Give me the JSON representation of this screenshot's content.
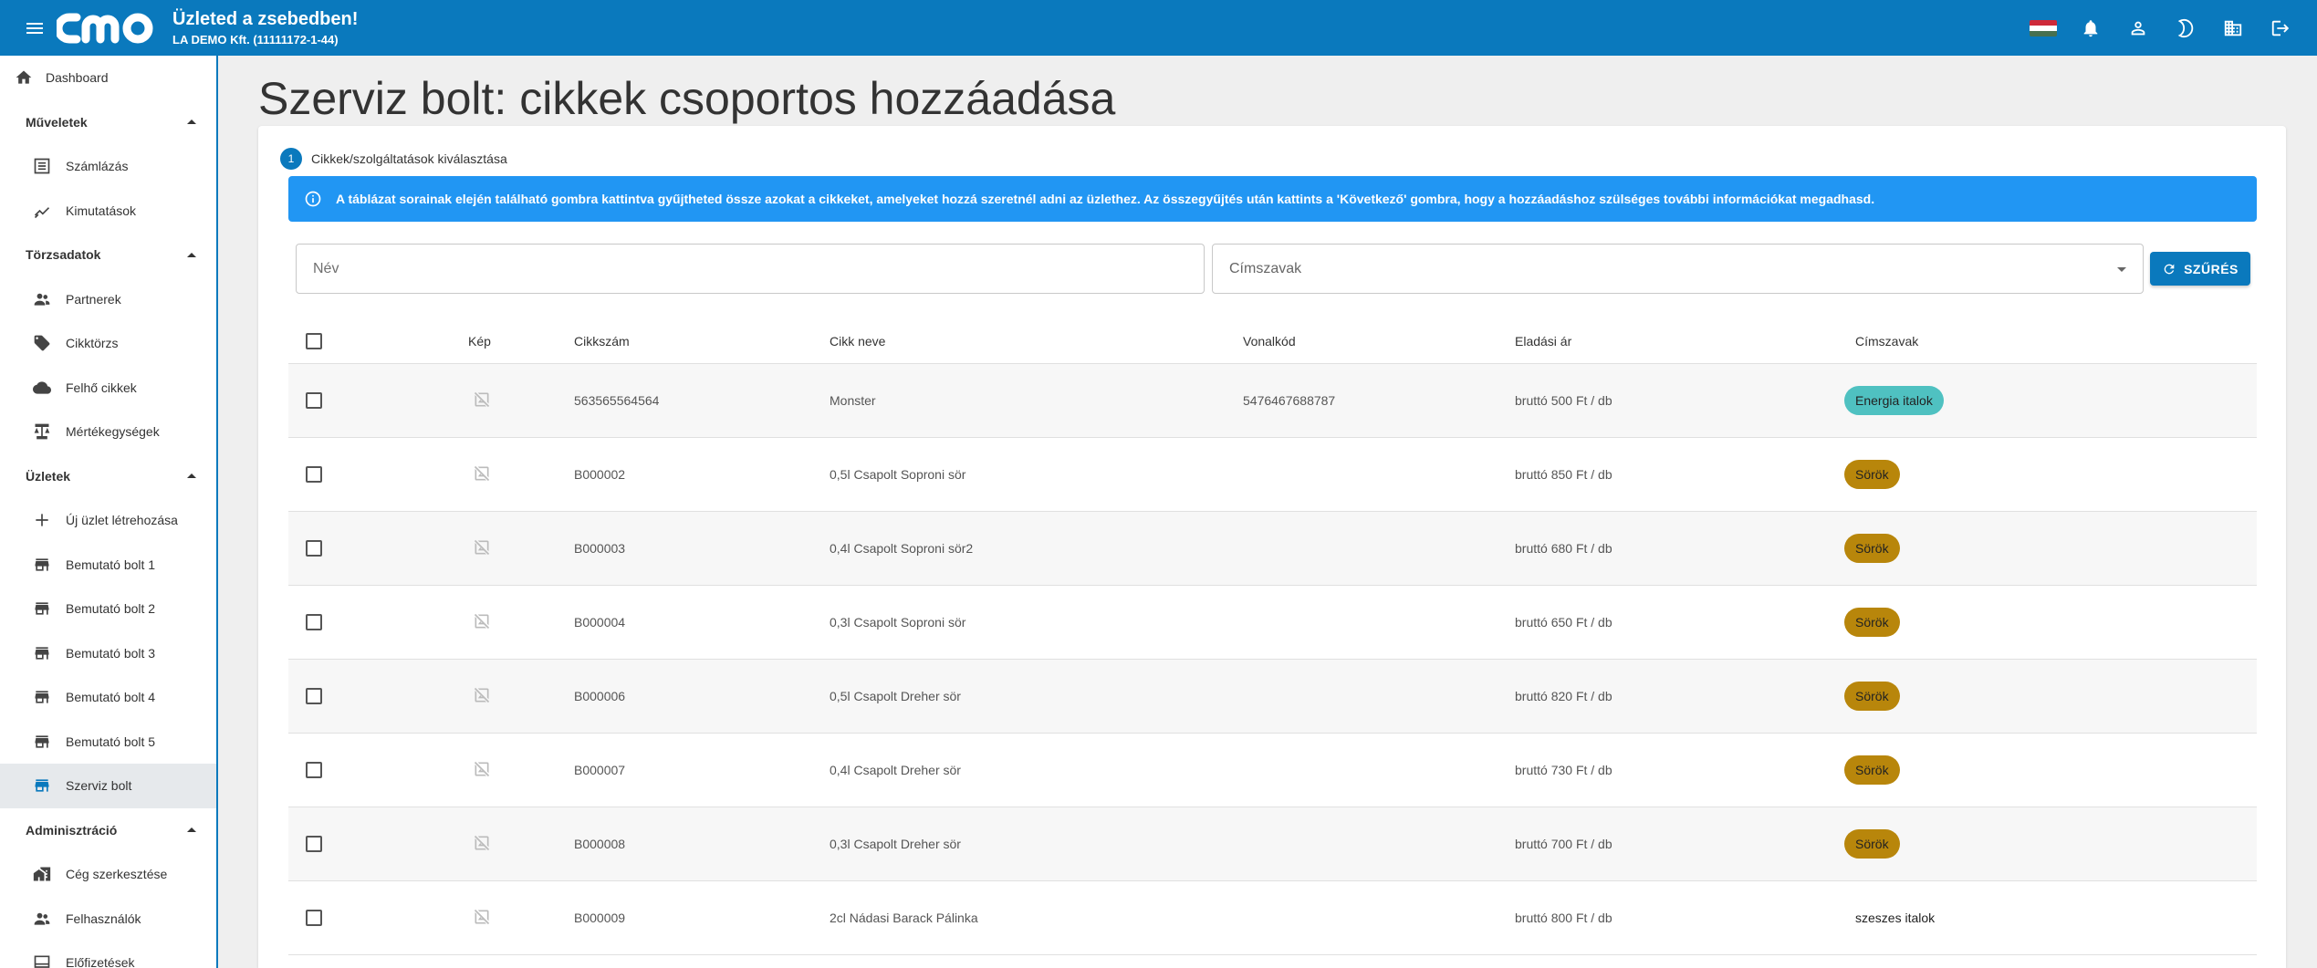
{
  "header": {
    "logo_text": "cmo",
    "title": "Üzleted a zsebedben!",
    "subtitle": "LA DEMO Kft. (11111172-1-44)",
    "flag_colors": [
      "#ce2939",
      "#ffffff",
      "#477050"
    ],
    "icons": [
      "hungarian-flag-icon",
      "bell-icon",
      "person-icon",
      "moon-icon",
      "building-icon",
      "logout-icon"
    ]
  },
  "sidebar": {
    "dashboard": "Dashboard",
    "sections": {
      "muveletek": "Műveletek",
      "torzsadatok": "Törzsadatok",
      "uzletek": "Üzletek",
      "adminisztracio": "Adminisztráció"
    },
    "items": {
      "szamlazas": "Számlázás",
      "kimutatasok": "Kimutatások",
      "partnerek": "Partnerek",
      "cikktorzs": "Cikktörzs",
      "felho": "Felhő cikkek",
      "mertekegysegek": "Mértékegységek",
      "uj_uzlet": "Új üzlet létrehozása",
      "bolt1": "Bemutató bolt 1",
      "bolt2": "Bemutató bolt 2",
      "bolt3": "Bemutató bolt 3",
      "bolt4": "Bemutató bolt 4",
      "bolt5": "Bemutató bolt 5",
      "szerviz": "Szerviz bolt",
      "ceg": "Cég szerkesztése",
      "felhasznalok": "Felhasználók",
      "elofizetesek": "Előfizetések"
    }
  },
  "main": {
    "title": "Szerviz bolt: cikkek csoportos hozzáadása",
    "step_number": "1",
    "step_label": "Cikkek/szolgáltatások kiválasztása",
    "info_text": "A táblázat sorainak elején található gombra kattintva gyűjtheted össze azokat a cikkeket, amelyeket hozzá szeretnél adni az üzlethez. Az összegyűjtés után kattints a 'Következő' gombra, hogy a hozzáadáshoz szülséges további információkat megadhasd.",
    "name_placeholder": "Név",
    "tags_placeholder": "Címszavak",
    "filter_label": "SZŰRÉS"
  },
  "table": {
    "headers": {
      "kep": "Kép",
      "cikkszam": "Cikkszám",
      "nev": "Cikk neve",
      "vonalkod": "Vonalkód",
      "ar": "Eladási ár",
      "cimszavak": "Címszavak"
    },
    "rows": [
      {
        "cikkszam": "563565564564",
        "nev": "Monster",
        "vonalkod": "5476467688787",
        "ar": "bruttó 500 Ft / db",
        "tag": "Energia italok",
        "tag_color": "#4fc1c1"
      },
      {
        "cikkszam": "B000002",
        "nev": "0,5l Csapolt Soproni sör",
        "vonalkod": "",
        "ar": "bruttó 850 Ft / db",
        "tag": "Sörök",
        "tag_color": "#b8860b"
      },
      {
        "cikkszam": "B000003",
        "nev": "0,4l Csapolt Soproni sör2",
        "vonalkod": "",
        "ar": "bruttó 680 Ft / db",
        "tag": "Sörök",
        "tag_color": "#b8860b"
      },
      {
        "cikkszam": "B000004",
        "nev": "0,3l Csapolt Soproni sör",
        "vonalkod": "",
        "ar": "bruttó 650 Ft / db",
        "tag": "Sörök",
        "tag_color": "#b8860b"
      },
      {
        "cikkszam": "B000006",
        "nev": "0,5l Csapolt Dreher sör",
        "vonalkod": "",
        "ar": "bruttó 820 Ft / db",
        "tag": "Sörök",
        "tag_color": "#b8860b"
      },
      {
        "cikkszam": "B000007",
        "nev": "0,4l Csapolt Dreher sör",
        "vonalkod": "",
        "ar": "bruttó 730 Ft / db",
        "tag": "Sörök",
        "tag_color": "#b8860b"
      },
      {
        "cikkszam": "B000008",
        "nev": "0,3l Csapolt Dreher sör",
        "vonalkod": "",
        "ar": "bruttó 700 Ft / db",
        "tag": "Sörök",
        "tag_color": "#b8860b"
      },
      {
        "cikkszam": "B000009",
        "nev": "2cl Nádasi Barack Pálinka",
        "vonalkod": "",
        "ar": "bruttó 800 Ft / db",
        "tag": "szeszes italok",
        "tag_color": ""
      }
    ]
  }
}
